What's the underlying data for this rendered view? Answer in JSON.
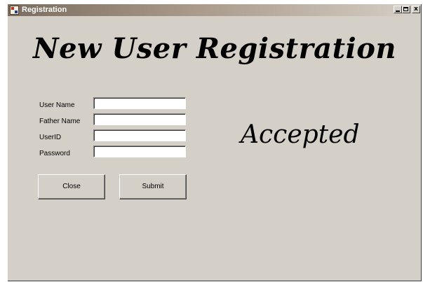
{
  "window": {
    "title": "Registration",
    "controls": {
      "minimize": "_",
      "maximize": "□",
      "close": "x"
    }
  },
  "form": {
    "heading": "New User Registration",
    "fields": [
      {
        "label": "User Name",
        "value": ""
      },
      {
        "label": "Father Name",
        "value": ""
      },
      {
        "label": "UserID",
        "value": ""
      },
      {
        "label": "Password",
        "value": ""
      }
    ],
    "buttons": {
      "close_label": "Close",
      "submit_label": "Submit"
    },
    "status_text": "Accepted"
  },
  "icons": {
    "app": "app-form-icon",
    "minimize": "minimize-icon",
    "maximize": "maximize-icon",
    "close": "close-icon"
  }
}
